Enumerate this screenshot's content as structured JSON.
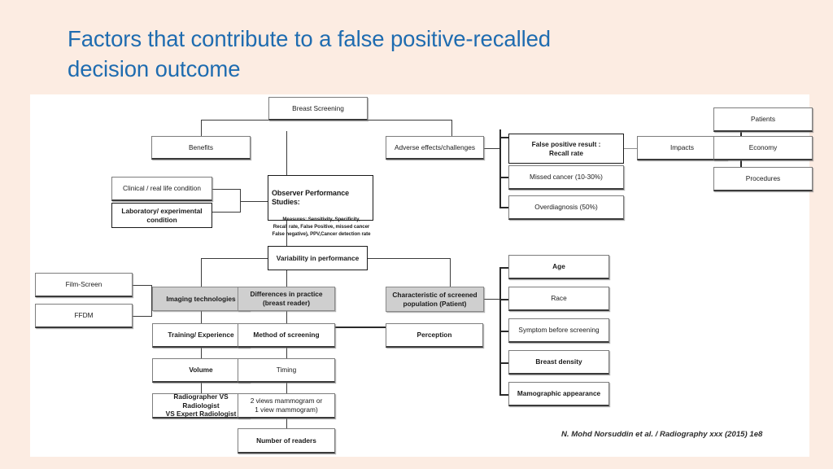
{
  "slide": {
    "title": "Factors that contribute to a false positive-recalled\ndecision outcome",
    "title_color": "#1f6cb0",
    "background_color": "#fcece2",
    "panel_color": "#ffffff",
    "citation": "N. Mohd Norsuddin et al. / Radiography xxx (2015) 1e8"
  },
  "diagram": {
    "type": "flowchart",
    "nodes": {
      "breast_screening": "Breast Screening",
      "benefits": "Benefits",
      "adverse_effects": "Adverse effects/challenges",
      "clinical_condition": "Clinical / real life condition",
      "laboratory_condition": "Laboratory/ experimental\ncondition",
      "observer_performance_title": "Observer Performance Studies:",
      "observer_performance_body": "Measures: Sensitivity, Specificity,\nRecall rate, False Positive, missed cancer\nFalse negative), PPV,Cancer detection rate",
      "false_positive": "False positive result :\nRecall rate",
      "missed_cancer": "Missed cancer (10-30%)",
      "overdiagnosis": "Overdiagnosis (50%)",
      "impacts": "Impacts",
      "patients": "Patients",
      "economy": "Economy",
      "procedures": "Procedures",
      "variability": "Variability in performance",
      "film_screen": "Film-Screen",
      "ffdm": "FFDM",
      "imaging_technologies": "Imaging technologies",
      "differences_in_practice": "Differences in practice\n(breast reader)",
      "characteristic_population": "Characteristic of screened\npopulation (Patient)",
      "training_experience": "Training/ Experience",
      "method_of_screening": "Method of screening",
      "perception": "Perception",
      "volume": "Volume",
      "timing": "Timing",
      "radiographer_vs": "Radiographer VS Radiologist\nVS Expert Radiologist",
      "views_mammogram": "2 views mammogram or\n1 view mammogram)",
      "number_of_readers": "Number of readers",
      "age": "Age",
      "race": "Race",
      "symptom_before_screening": "Symptom before screening",
      "breast_density": "Breast density",
      "mamographic_appearance": "Mamographic appearance"
    }
  }
}
